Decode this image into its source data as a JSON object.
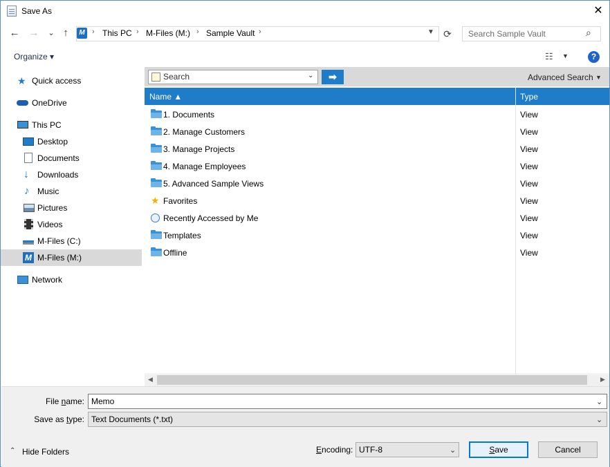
{
  "window": {
    "title": "Save As",
    "close_glyph": "✕"
  },
  "nav": {
    "back": "←",
    "forward": "→",
    "recent": "⌄",
    "up": "↑",
    "breadcrumb": [
      "This PC",
      "M-Files (M:)",
      "Sample Vault"
    ],
    "vault_icon_letter": "M",
    "refresh": "⟳",
    "search_placeholder": "Search Sample Vault"
  },
  "commandbar": {
    "organize": "Organize ▾",
    "help": "?"
  },
  "sidebar": {
    "items": [
      {
        "label": "Quick access",
        "icon": "star-pin-icon"
      },
      {
        "label": "OneDrive",
        "icon": "cloud-icon"
      },
      {
        "label": "This PC",
        "icon": "computer-icon"
      },
      {
        "label": "Desktop",
        "icon": "desktop-icon"
      },
      {
        "label": "Documents",
        "icon": "documents-icon"
      },
      {
        "label": "Downloads",
        "icon": "download-icon"
      },
      {
        "label": "Music",
        "icon": "music-icon"
      },
      {
        "label": "Pictures",
        "icon": "pictures-icon"
      },
      {
        "label": "Videos",
        "icon": "videos-icon"
      },
      {
        "label": "M-Files (C:)",
        "icon": "drive-icon"
      },
      {
        "label": "M-Files (M:)",
        "icon": "mfiles-drive-icon"
      },
      {
        "label": "Network",
        "icon": "network-icon"
      }
    ],
    "selected": "M-Files (M:)"
  },
  "mfiles_bar": {
    "search_text": "Search",
    "advanced": "Advanced Search",
    "go": "➡"
  },
  "table": {
    "headers": {
      "name": "Name ▲",
      "type": "Type"
    },
    "rows": [
      {
        "name": "1. Documents",
        "type": "View",
        "icon": "folder-icon"
      },
      {
        "name": "2. Manage Customers",
        "type": "View",
        "icon": "folder-icon"
      },
      {
        "name": "3. Manage Projects",
        "type": "View",
        "icon": "folder-icon"
      },
      {
        "name": "4. Manage Employees",
        "type": "View",
        "icon": "folder-icon"
      },
      {
        "name": "5. Advanced Sample Views",
        "type": "View",
        "icon": "folder-icon"
      },
      {
        "name": "Favorites",
        "type": "View",
        "icon": "star-icon"
      },
      {
        "name": "Recently Accessed by Me",
        "type": "View",
        "icon": "clock-icon"
      },
      {
        "name": "Templates",
        "type": "View",
        "icon": "folder-icon"
      },
      {
        "name": "Offline",
        "type": "View",
        "icon": "folder-icon"
      }
    ]
  },
  "form": {
    "filename_label_pre": "File ",
    "filename_label_u": "n",
    "filename_label_post": "ame:",
    "filename_value": "Memo",
    "type_label_pre": "Save as ",
    "type_label_u": "t",
    "type_label_post": "ype:",
    "type_value": "Text Documents (*.txt)",
    "hide_folders": "Hide Folders",
    "encoding_label_pre": "",
    "encoding_label_u": "E",
    "encoding_label_post": "ncoding:",
    "encoding_value": "UTF-8",
    "save_u": "S",
    "save_rest": "ave",
    "cancel": "Cancel"
  }
}
